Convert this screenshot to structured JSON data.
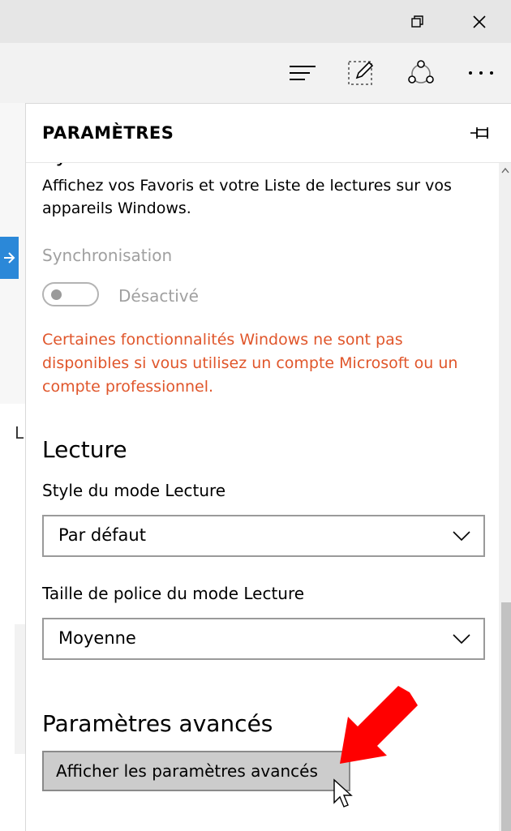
{
  "window": {
    "minimize_icon": "restore-icon",
    "close_icon": "close-icon"
  },
  "toolbar": {
    "hub_icon": "hub-icon",
    "note_icon": "web-note-icon",
    "share_icon": "share-icon",
    "more_icon": "more-icon"
  },
  "panel": {
    "title": "PARAMÈTRES",
    "sync": {
      "heading_partial": "Synchroniser votre contenu",
      "description_line1": "Affichez vos Favoris et votre Liste de lectures sur vos",
      "description_line2": "appareils Windows.",
      "label": "Synchronisation",
      "toggle_state": "Désactivé",
      "warning_line1": "Certaines fonctionnalités Windows ne sont pas",
      "warning_line2": "disponibles si vous utilisez un compte Microsoft ou un",
      "warning_line3": "compte professionnel."
    },
    "reading": {
      "heading": "Lecture",
      "style_label": "Style du mode Lecture",
      "style_value": "Par défaut",
      "font_label": "Taille de police du mode Lecture",
      "font_value": "Moyenne"
    },
    "advanced": {
      "heading": "Paramètres avancés",
      "button_label": "Afficher les paramètres avancés"
    }
  },
  "background": {
    "letter": "L"
  },
  "colors": {
    "warning": "#e0562b",
    "accent": "#2b88d8",
    "annotation": "#ff0000"
  }
}
